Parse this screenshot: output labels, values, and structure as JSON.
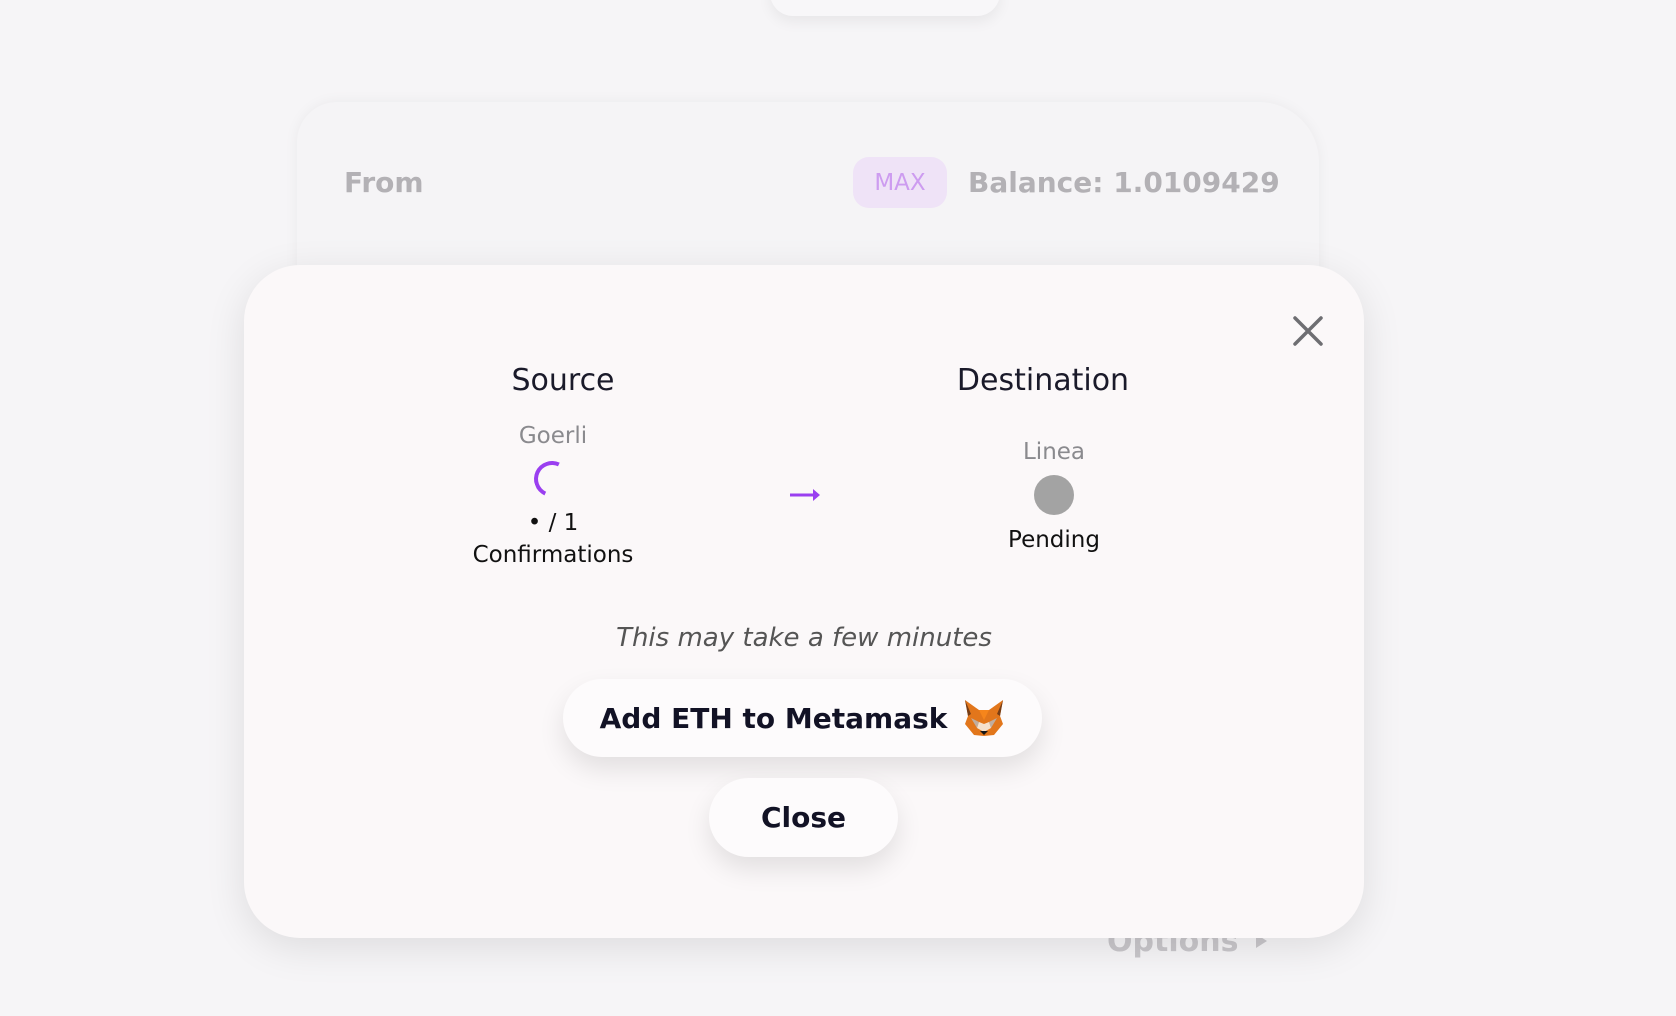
{
  "background_card": {
    "from_label": "From",
    "max_label": "MAX",
    "balance_text": "Balance: 1.0109429",
    "options_label": "Options"
  },
  "modal": {
    "source": {
      "title": "Source",
      "network": "Goerli",
      "confirmations": "• / 1",
      "confirmations_label": "Confirmations"
    },
    "destination": {
      "title": "Destination",
      "network": "Linea",
      "status": "Pending"
    },
    "hint": "This may take a few minutes",
    "add_token_button": "Add ETH to Metamask",
    "close_button": "Close",
    "colors": {
      "accent": "#9a3ff0",
      "pending": "#a3a3a3"
    },
    "icons": [
      "close-icon",
      "spinner-icon",
      "arrow-right-icon",
      "metamask-fox-icon"
    ]
  }
}
